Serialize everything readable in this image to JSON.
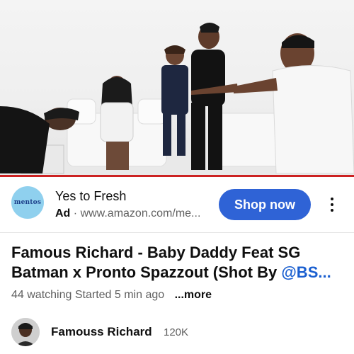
{
  "ad": {
    "logo_text": "mentos",
    "advertiser": "Yes to Fresh",
    "ad_label": "Ad",
    "separator": "·",
    "url": "www.amazon.com/me...",
    "cta_label": "Shop now",
    "logo_color": "#8fd0ee",
    "cta_color": "#2f63d6"
  },
  "video": {
    "title_line1": "Famous Richard - Baby Daddy Feat SG",
    "title_line2_text": "Batman x Pronto Spazzout (Shot By ",
    "title_mention": "@BS...",
    "watching": "44 watching",
    "started": "Started 5 min ago",
    "more_label": "...more",
    "progress_color": "#cc2222"
  },
  "channel": {
    "name": "Famouss Richard",
    "subscribers": "120K"
  }
}
